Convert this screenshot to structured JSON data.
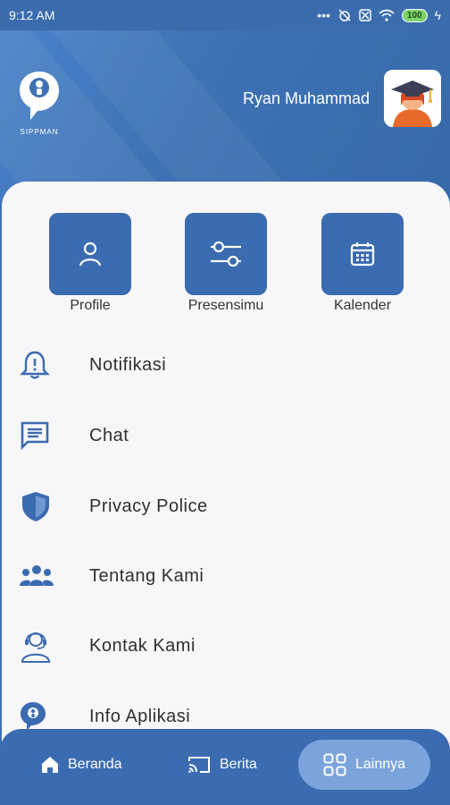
{
  "status": {
    "time": "9:12 AM",
    "battery": "100"
  },
  "header": {
    "logo_text": "SIPPMAN",
    "user_name": "Ryan Muhammad"
  },
  "quick_actions": [
    {
      "label": "Profile",
      "icon": "person-icon"
    },
    {
      "label": "Presensimu",
      "icon": "sliders-icon"
    },
    {
      "label": "Kalender",
      "icon": "calendar-icon"
    }
  ],
  "menu": [
    {
      "label": "Notifikasi",
      "icon": "bell-alert-icon"
    },
    {
      "label": "Chat",
      "icon": "chat-icon"
    },
    {
      "label": "Privacy Police",
      "icon": "shield-icon"
    },
    {
      "label": "Tentang Kami",
      "icon": "group-icon"
    },
    {
      "label": "Kontak Kami",
      "icon": "support-agent-icon"
    },
    {
      "label": "Info Aplikasi",
      "icon": "app-logo-icon"
    }
  ],
  "nav": [
    {
      "label": "Beranda",
      "icon": "home-icon"
    },
    {
      "label": "Berita",
      "icon": "cast-icon"
    },
    {
      "label": "Lainnya",
      "icon": "grid-icon",
      "active": true
    }
  ],
  "colors": {
    "primary": "#3b6bb0",
    "active_pill": "#7ba4dc",
    "background": "#f7f7f9"
  }
}
